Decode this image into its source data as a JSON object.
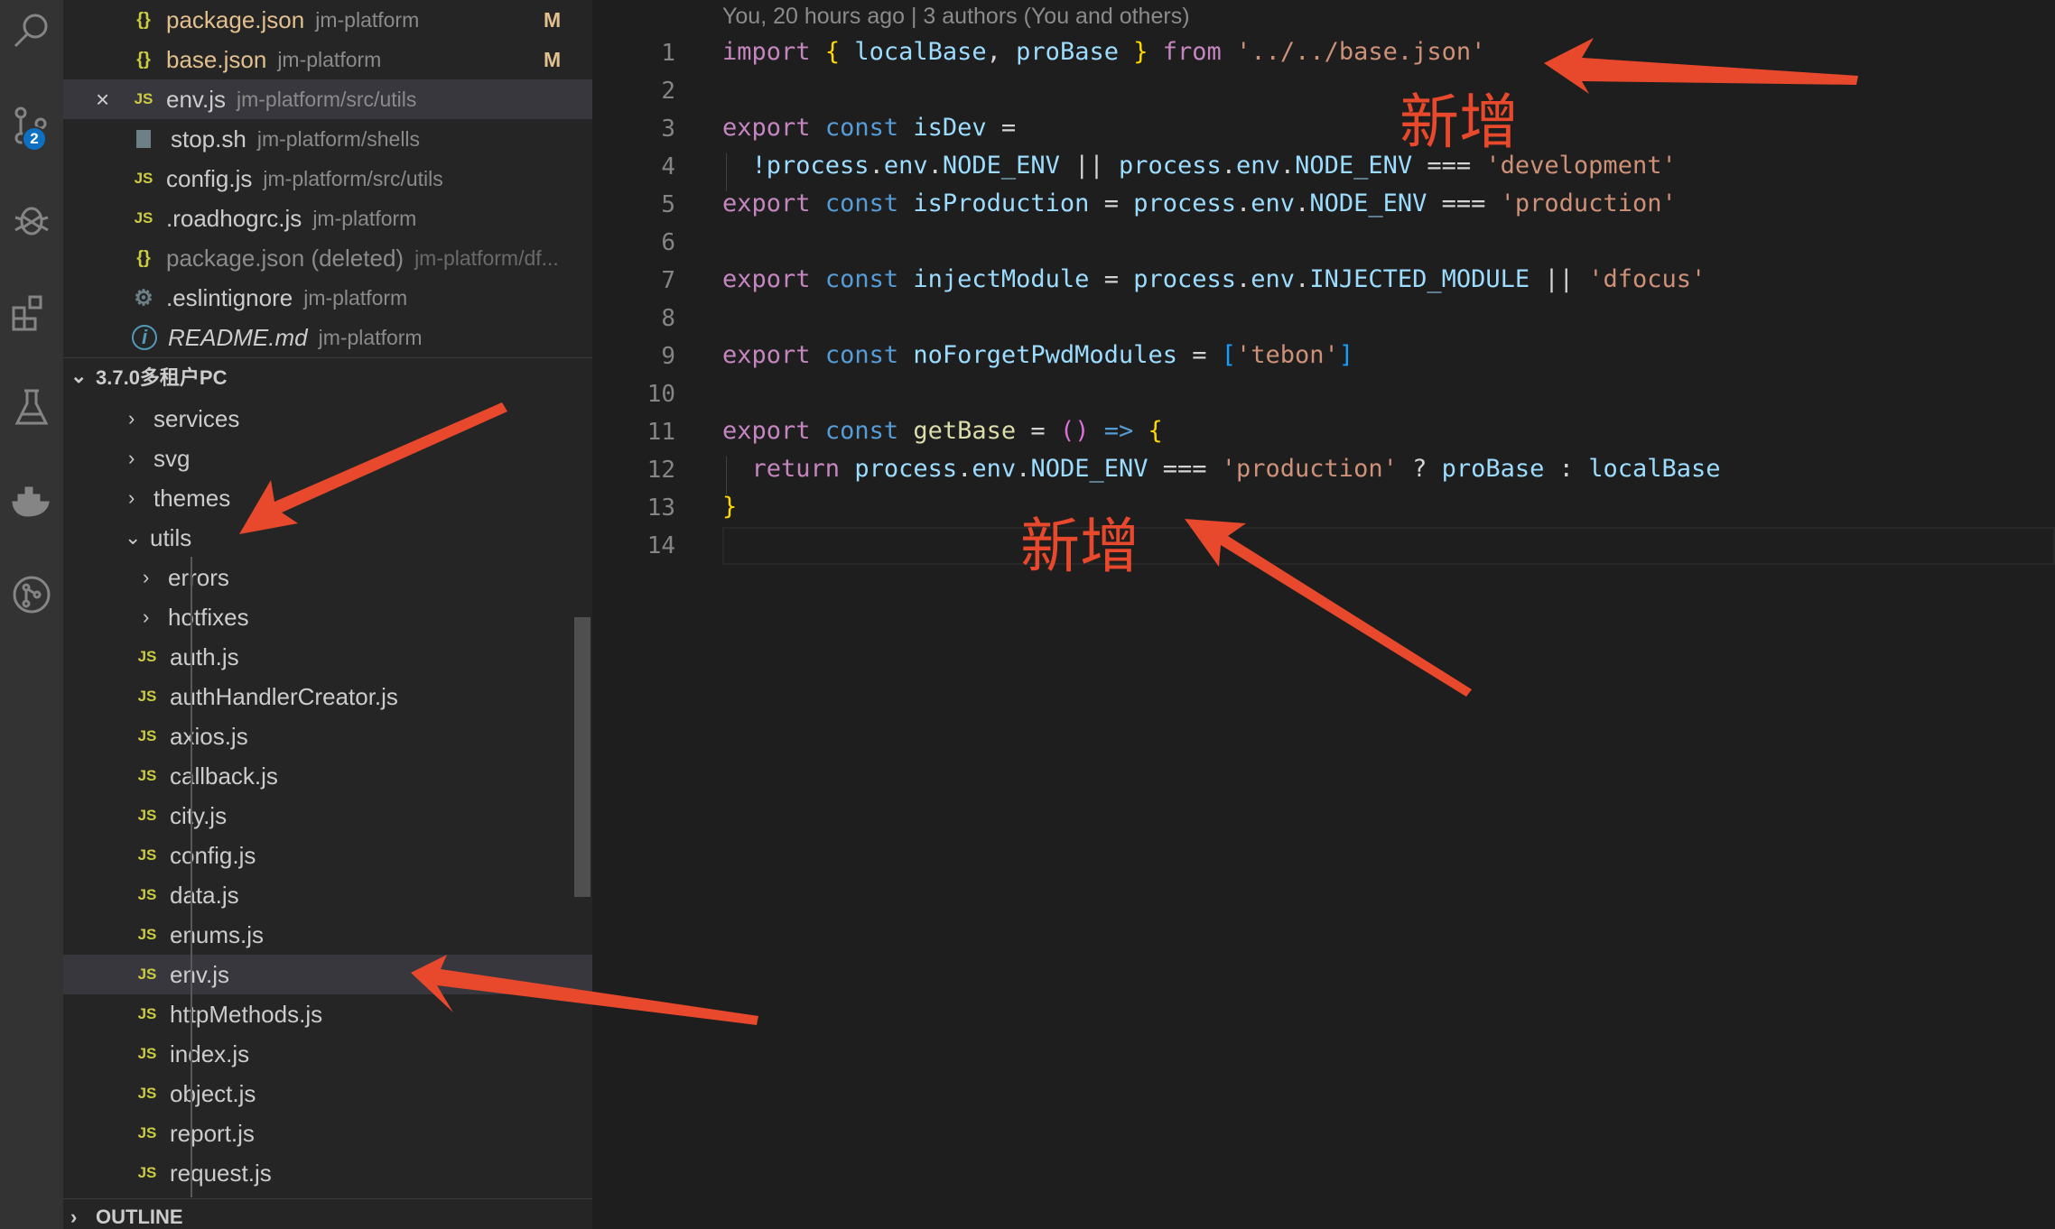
{
  "activity_bar": {
    "icons": [
      "search-icon",
      "source-control-icon",
      "debug-icon",
      "extensions-icon",
      "testing-icon",
      "docker-icon",
      "git-graph-icon"
    ],
    "scm_badge": "2"
  },
  "open_editors": [
    {
      "icon": "json",
      "name": "package.json",
      "path": "jm-platform",
      "status": "M"
    },
    {
      "icon": "json",
      "name": "base.json",
      "path": "jm-platform",
      "status": "M"
    },
    {
      "icon": "js",
      "name": "env.js",
      "path": "jm-platform/src/utils",
      "close": "×"
    },
    {
      "icon": "sh",
      "name": "stop.sh",
      "path": "jm-platform/shells"
    },
    {
      "icon": "js",
      "name": "config.js",
      "path": "jm-platform/src/utils"
    },
    {
      "icon": "js",
      "name": ".roadhogrc.js",
      "path": "jm-platform"
    },
    {
      "icon": "json",
      "name": "package.json (deleted)",
      "path": "jm-platform/df..."
    },
    {
      "icon": "cfg",
      "name": ".eslintignore",
      "path": "jm-platform"
    },
    {
      "icon": "info",
      "name": "README.md",
      "path": "jm-platform"
    }
  ],
  "workspace": {
    "title": "3.7.0多租户PC",
    "folders": [
      "services",
      "svg",
      "themes",
      "utils"
    ],
    "utils_subfolders": [
      "errors",
      "hotfixes"
    ],
    "utils_files": [
      "auth.js",
      "authHandlerCreator.js",
      "axios.js",
      "callback.js",
      "city.js",
      "config.js",
      "data.js",
      "enums.js",
      "env.js",
      "httpMethods.js",
      "index.js",
      "object.js",
      "report.js",
      "request.js"
    ]
  },
  "outline_label": "OUTLINE",
  "editor": {
    "blame": "You, 20 hours ago | 3 authors (You and others)",
    "line_numbers": [
      "1",
      "2",
      "3",
      "4",
      "5",
      "6",
      "7",
      "8",
      "9",
      "10",
      "11",
      "12",
      "13",
      "14"
    ],
    "tokens": {
      "import": "import",
      "export": "export",
      "const": "const",
      "return": "return",
      "from": "from",
      "localBase": "localBase",
      "proBase": "proBase",
      "base_json": "'../../base.json'",
      "isDev": "isDev",
      "not_process": "!process",
      "process": "process",
      "env": "env",
      "node_env": "NODE_ENV",
      "development": "'development'",
      "isProduction": "isProduction",
      "production": "'production'",
      "injectModule": "injectModule",
      "injected_module": "INJECTED_MODULE",
      "dfocus": "'dfocus'",
      "noForgetPwdModules": "noForgetPwdModules",
      "tebon": "'tebon'",
      "getBase": "getBase"
    }
  },
  "annotations": [
    "新增",
    "新增"
  ],
  "colors": {
    "arrow": "#e8492c",
    "selection": "#37373d",
    "js_icon": "#cbcb41"
  }
}
